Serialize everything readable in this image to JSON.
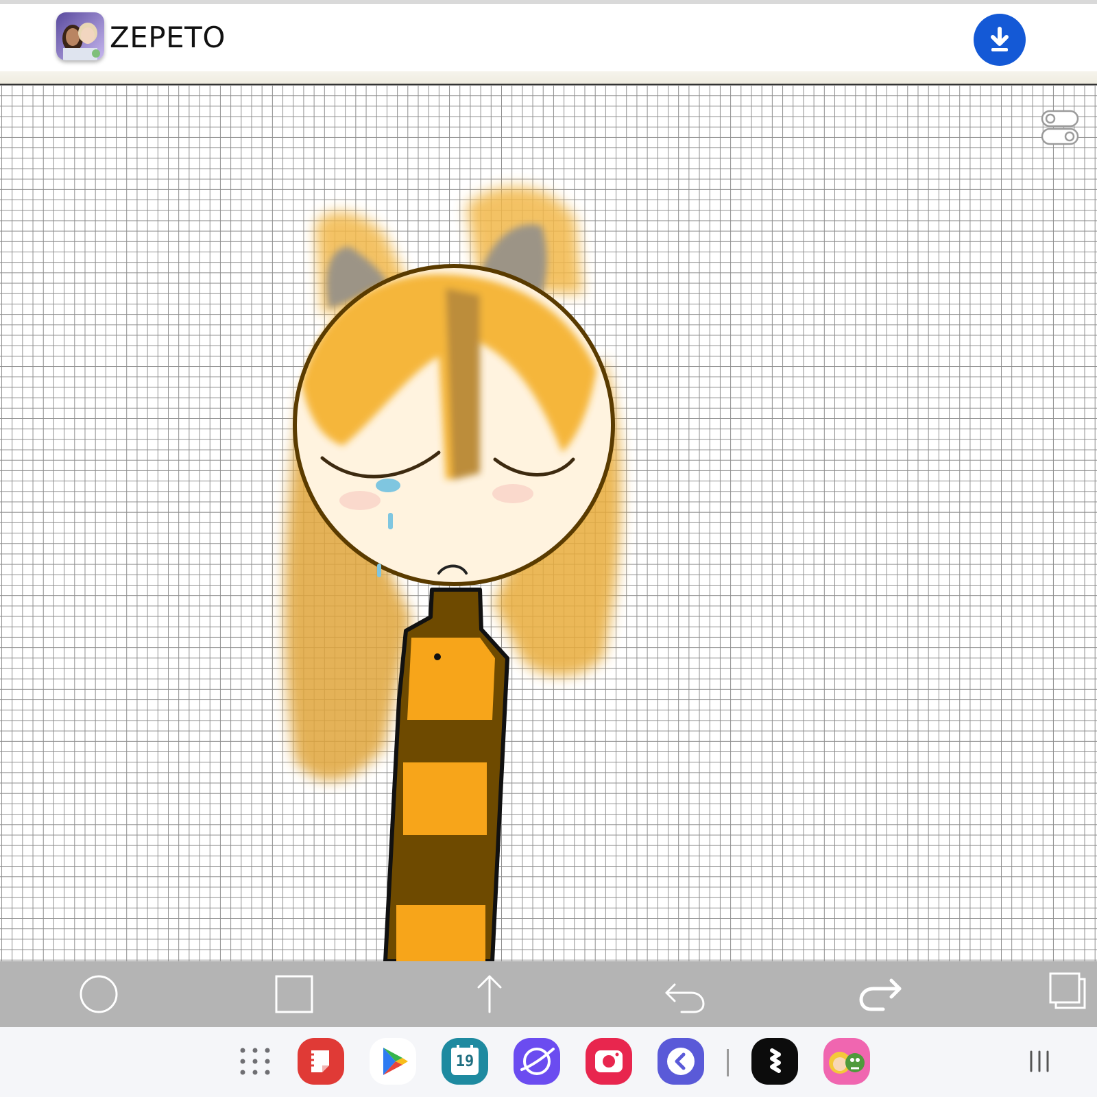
{
  "header": {
    "app_title": "ZEPETO",
    "logo_icon": "zepeto-avatar-logo-icon",
    "download_icon": "download-icon",
    "download_color": "#1459d6"
  },
  "canvas": {
    "grid_color": "#8d8d8d",
    "layer_toggle_icon": "layer-toggle-icon"
  },
  "toolbar": {
    "tools": [
      {
        "name": "circle-tool",
        "icon": "circle-outline-icon"
      },
      {
        "name": "square-tool",
        "icon": "square-outline-icon"
      },
      {
        "name": "move-up-tool",
        "icon": "arrow-up-icon"
      },
      {
        "name": "undo-tool",
        "icon": "undo-icon"
      },
      {
        "name": "redo-tool",
        "icon": "redo-icon"
      },
      {
        "name": "layers-tool",
        "icon": "stacked-squares-icon"
      }
    ]
  },
  "dock": {
    "calendar_date": "19",
    "apps": [
      {
        "name": "app-drawer",
        "icon": "grid-dots-icon"
      },
      {
        "name": "samsung-notes",
        "icon": "notes-icon",
        "color": "#e03a36"
      },
      {
        "name": "play-store",
        "icon": "play-store-icon"
      },
      {
        "name": "calendar",
        "icon": "calendar-icon",
        "color": "#1e8aa0"
      },
      {
        "name": "internet",
        "icon": "browser-planet-icon",
        "color": "#6b4cf0"
      },
      {
        "name": "screen-recorder",
        "icon": "camera-icon",
        "color": "#e8264e"
      },
      {
        "name": "edge-panel",
        "icon": "back-chevron-icon",
        "color": "#5a5ad8"
      },
      {
        "name": "threads-style-app",
        "icon": "s-logo-icon",
        "color": "#0c0c0c"
      },
      {
        "name": "game-app",
        "icon": "game-characters-icon"
      }
    ],
    "recents_icon": "recents-bars-icon"
  }
}
